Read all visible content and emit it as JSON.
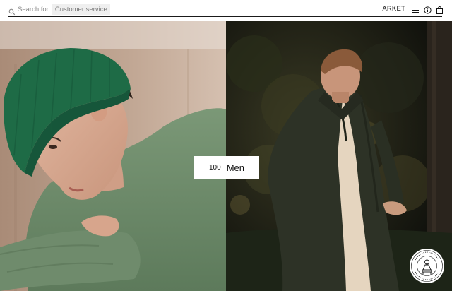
{
  "header": {
    "search": {
      "placeholder": "Search for",
      "suggestion": "Customer service",
      "icon": "search-icon"
    },
    "brand": "ARKET",
    "icons": [
      "menu-icon",
      "info-icon",
      "bag-icon"
    ]
  },
  "hero": {
    "left_image": "man-in-green-beanie-photo",
    "right_image": "man-in-dark-coat-photo",
    "tile": {
      "count": "100",
      "label": "Men"
    },
    "badge": "circular-stamp-badge"
  },
  "colors": {
    "beanie": "#1e6b46",
    "sweater": "#6d8a6a",
    "coat": "#2d3226",
    "forest": "#141611"
  }
}
